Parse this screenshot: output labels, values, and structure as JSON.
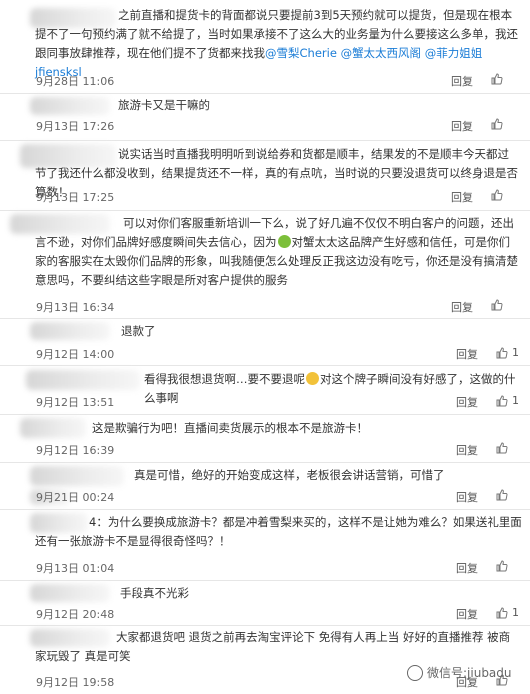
{
  "actions": {
    "reply": "回复"
  },
  "comments": [
    {
      "text_pre": "之前直播和提货卡的背面都说只要提前3到5天预约就可以提货，但是现在根本提不了一句预约满了就不给提了，当时如果承接不了这么大的业务量为什么要接这么多单，我还跟同事放肆推荐，现在他们提不了货都来找我",
      "mention1": "@雪梨Cherie",
      "mention2": "@蟹太太西风阁",
      "mention3": "@菲力姐姐jfiensksl",
      "date": "9月28日 11:06",
      "likes": ""
    },
    {
      "text": "旅游卡又是干嘛的",
      "date": "9月13日 17:26",
      "likes": ""
    },
    {
      "text": "说实话当时直播我明明听到说给券和货都是顺丰，结果发的不是顺丰今天都过节了我还什么都没收到，结果提货还不一样，真的有点吭，当时说的只要没退货可以终身退是否算数！",
      "date": "9月13日 17:25",
      "likes": ""
    },
    {
      "text_pre": "可以对你们客服重新培训一下么，说了好几遍不仅仅不明白客户的问题，还出言不逊，对你们品牌好感度瞬间失去信心，因为",
      "text_post": "对蟹太太这品牌产生好感和信任，可是你们家的客服实在太毁你们品牌的形象，叫我随便怎么处理反正我这边没有吃亏，你还是没有搞清楚意思吗，不要纠结这些字眼是所对客户提供的服务",
      "date": "9月13日 16:34",
      "likes": ""
    },
    {
      "text": "退款了",
      "date": "9月12日 14:00",
      "likes": "1"
    },
    {
      "text_pre": "看得我很想退货啊…要不要退呢",
      "text_post": "对这个牌子瞬间没有好感了，这做的什么事啊",
      "date": "9月12日 13:51",
      "likes": "1"
    },
    {
      "text": "这是欺骗行为吧！直播间卖货展示的根本不是旅游卡！",
      "date": "9月12日 16:39",
      "likes": ""
    },
    {
      "text": "真是可惜，绝好的开始变成这样，老板很会讲话营销，可惜了",
      "date": "9月21日 00:24",
      "likes": ""
    },
    {
      "text": "4：为什么要换成旅游卡？都是冲着雪梨来买的，这样不是让她为难么？如果送礼里面还有一张旅游卡不是显得很奇怪吗？！",
      "date": "9月13日 01:04",
      "likes": ""
    },
    {
      "text": "手段真不光彩",
      "date": "9月12日 20:48",
      "likes": "1"
    },
    {
      "text": "大家都退货吧 退货之前再去淘宝评论下 免得有人再上当 好好的直播推荐 被商家玩毁了 真是可笑",
      "date": "9月12日 19:58",
      "likes": ""
    }
  ],
  "watermark": {
    "text": "微信号:jiubadu"
  },
  "colors": {
    "mention": "#1a7cd6",
    "date": "#666666",
    "divider": "#e6e6e6"
  }
}
